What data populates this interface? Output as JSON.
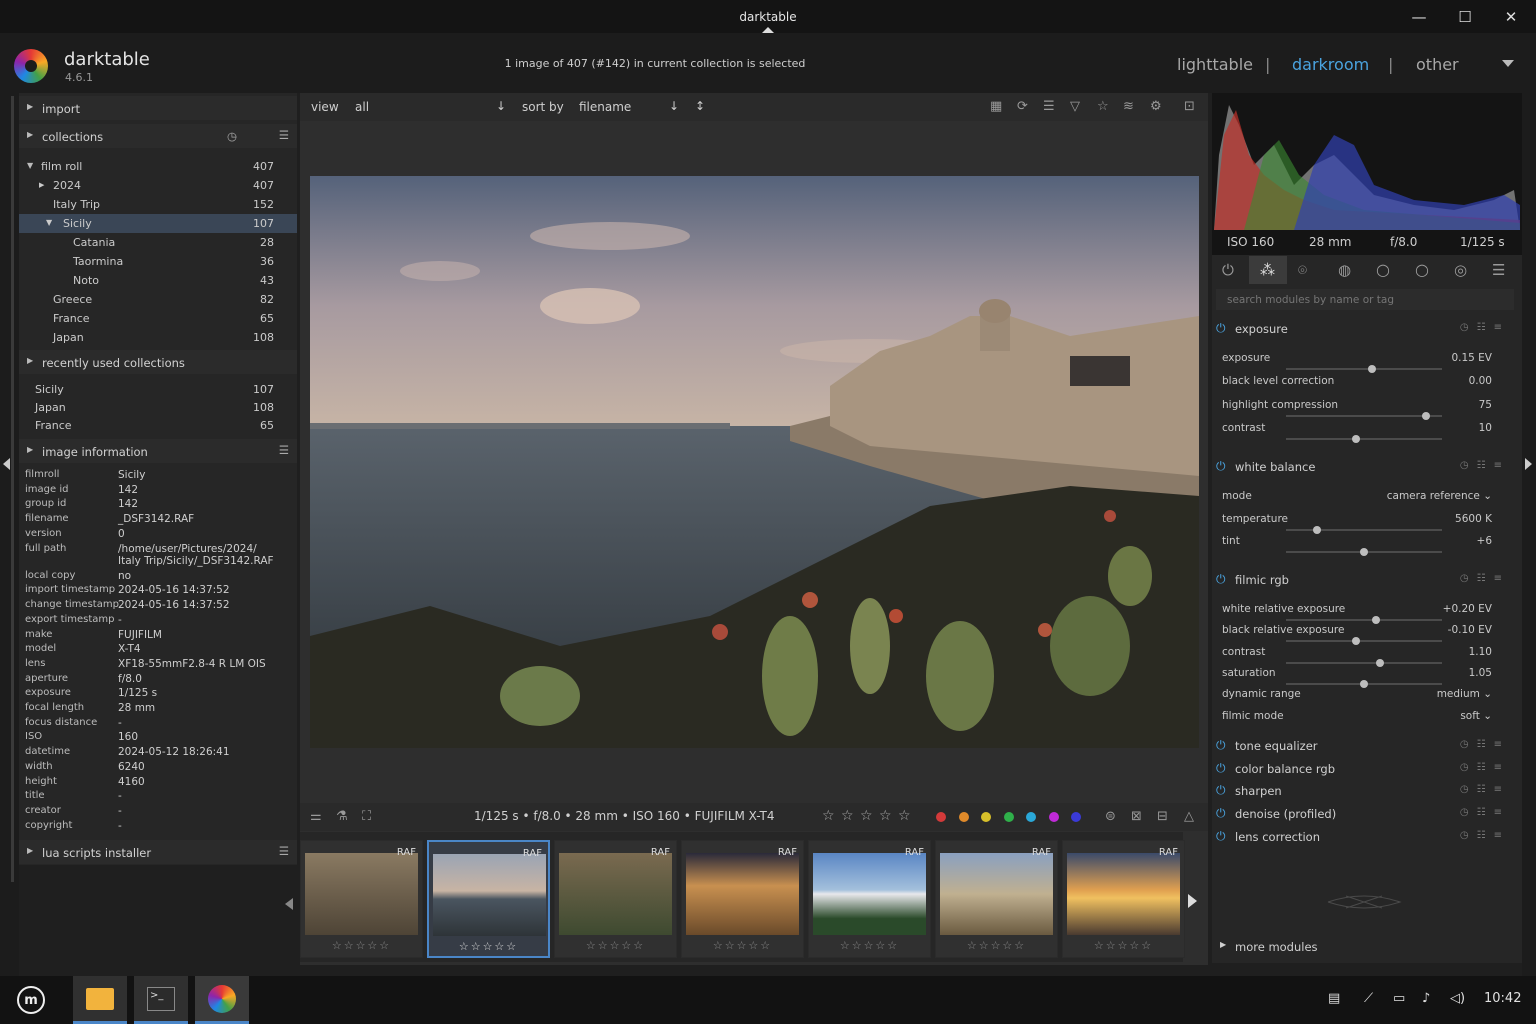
{
  "window": {
    "title": "darktable"
  },
  "app": {
    "name": "darktable",
    "version": "4.6.1"
  },
  "header": {
    "selection_info": "1 image of 407 (#142) in current collection is selected",
    "views": [
      "lighttable",
      "darkroom",
      "other"
    ],
    "active_view": "darkroom",
    "separator": "|"
  },
  "left": {
    "import": "import",
    "collections": "collections",
    "film_roll": {
      "label": "film roll",
      "count": "407",
      "items": [
        {
          "label": "2024",
          "count": "407"
        },
        {
          "label": "Italy Trip",
          "count": "152"
        },
        {
          "label": "Sicily",
          "count": "107"
        },
        {
          "label": "Catania",
          "count": "28"
        },
        {
          "label": "Taormina",
          "count": "36"
        },
        {
          "label": "Noto",
          "count": "43"
        },
        {
          "label": "Greece",
          "count": "82"
        },
        {
          "label": "France",
          "count": "65"
        },
        {
          "label": "Japan",
          "count": "108"
        }
      ]
    },
    "recent": {
      "label": "recently used collections",
      "items": [
        {
          "label": "Sicily",
          "count": "107"
        },
        {
          "label": "Japan",
          "count": "108"
        },
        {
          "label": "France",
          "count": "65"
        }
      ]
    },
    "image_information": "image information",
    "info": [
      {
        "k": "filmroll",
        "v": "Sicily"
      },
      {
        "k": "image id",
        "v": "142"
      },
      {
        "k": "group id",
        "v": "142"
      },
      {
        "k": "filename",
        "v": "_DSF3142.RAF"
      },
      {
        "k": "version",
        "v": "0"
      },
      {
        "k": "full path",
        "v": "/home/user/Pictures/2024/"
      },
      {
        "k": "",
        "v": "Italy Trip/Sicily/_DSF3142.RAF"
      },
      {
        "k": "local copy",
        "v": "no"
      },
      {
        "k": "import timestamp",
        "v": "2024-05-16 14:37:52"
      },
      {
        "k": "change timestamp",
        "v": "2024-05-16 14:37:52"
      },
      {
        "k": "export timestamp",
        "v": "-"
      },
      {
        "k": "make",
        "v": "FUJIFILM"
      },
      {
        "k": "model",
        "v": "X-T4"
      },
      {
        "k": "lens",
        "v": "XF18-55mmF2.8-4 R LM OIS"
      },
      {
        "k": "aperture",
        "v": "f/8.0"
      },
      {
        "k": "exposure",
        "v": "1/125 s"
      },
      {
        "k": "focal length",
        "v": "28 mm"
      },
      {
        "k": "focus distance",
        "v": "-"
      },
      {
        "k": "ISO",
        "v": "160"
      },
      {
        "k": "datetime",
        "v": "2024-05-12 18:26:41"
      },
      {
        "k": "width",
        "v": "6240"
      },
      {
        "k": "height",
        "v": "4160"
      },
      {
        "k": "title",
        "v": "-"
      },
      {
        "k": "creator",
        "v": "-"
      },
      {
        "k": "copyright",
        "v": "-"
      }
    ],
    "lua": "lua scripts installer"
  },
  "topbar": {
    "view_label": "view",
    "view_value": "all",
    "sort_label": "sort by",
    "sort_value": "filename"
  },
  "infobar": "1/125 s  •  f/8.0  •  28 mm  •  ISO 160  •  FUJIFILM X-T4",
  "stars": "☆ ☆ ☆ ☆ ☆",
  "filmstrip": {
    "badge": "RAF",
    "stars": "☆☆☆☆☆"
  },
  "right": {
    "exif": {
      "iso": "ISO 160",
      "focal": "28 mm",
      "aperture": "f/8.0",
      "shutter": "1/125 s"
    },
    "search_placeholder": "search modules by name or tag",
    "exposure": {
      "title": "exposure",
      "params": [
        {
          "label": "exposure",
          "value": "0.15 EV",
          "level": 0.55
        },
        {
          "label": "black level correction",
          "value": "0.00",
          "level": null
        },
        {
          "label": "highlight compression",
          "value": "75",
          "level": 0.9
        },
        {
          "label": "contrast",
          "value": "10",
          "level": 0.45
        }
      ]
    },
    "white_balance": {
      "title": "white balance",
      "params": [
        {
          "label": "mode",
          "value": "camera reference ⌄"
        },
        {
          "label": "temperature",
          "value": "5600 K",
          "level": 0.2
        },
        {
          "label": "tint",
          "value": "+6",
          "level": 0.5
        }
      ]
    },
    "filmic": {
      "title": "filmic rgb",
      "params": [
        {
          "label": "white relative exposure",
          "value": "+0.20 EV",
          "level": 0.58
        },
        {
          "label": "black relative exposure",
          "value": "-0.10 EV",
          "level": 0.45
        },
        {
          "label": "contrast",
          "value": "1.10",
          "level": 0.6
        },
        {
          "label": "saturation",
          "value": "1.05",
          "level": 0.5
        },
        {
          "label": "dynamic range",
          "value": "medium ⌄"
        },
        {
          "label": "filmic mode",
          "value": "soft ⌄"
        }
      ]
    },
    "modules": [
      "tone equalizer",
      "color balance rgb",
      "sharpen",
      "denoise (profiled)",
      "lens correction"
    ],
    "more": "more modules"
  },
  "taskbar": {
    "time": "10:42"
  }
}
